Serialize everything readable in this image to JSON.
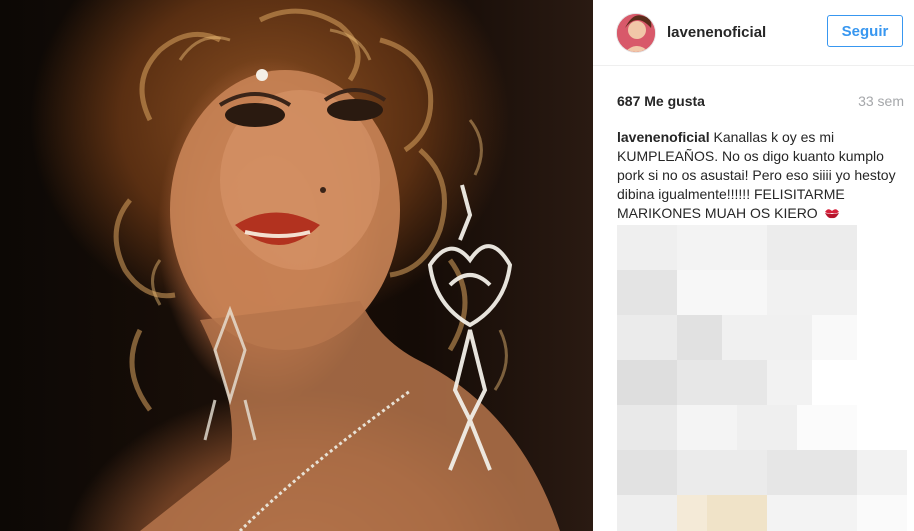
{
  "post": {
    "username": "lavenenoficial",
    "follow_label": "Seguir",
    "likes": "687 Me gusta",
    "time_ago": "33 sem",
    "caption_user": "lavenenoficial",
    "caption_text": "Kanallas k oy es mi KUMPLEAÑOS. No os digo kuanto kumplo pork si no os asustai! Pero eso siiii yo hestoy dibina igualmente!!!!!! FELISITARME MARIKONES MUAH OS KIERO",
    "caption_emoji": "kiss-mark-icon"
  },
  "colors": {
    "follow_blue": "#3897f0",
    "text": "#262626",
    "muted": "#a5a7aa"
  }
}
